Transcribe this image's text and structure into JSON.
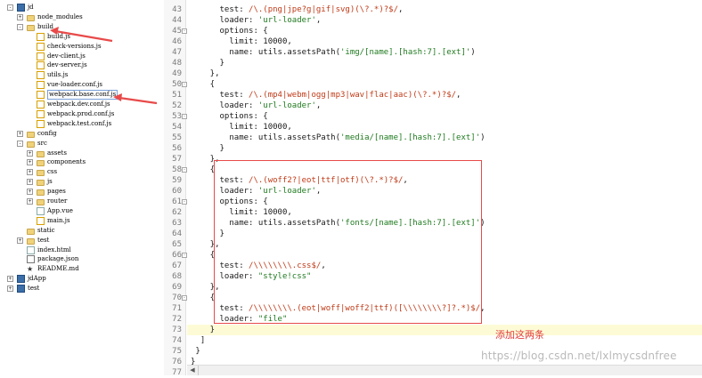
{
  "tree": {
    "items": [
      {
        "label": "jd",
        "level": 0,
        "icon": "project",
        "toggle": "-"
      },
      {
        "label": "node_modules",
        "level": 1,
        "icon": "folder",
        "toggle": "+"
      },
      {
        "label": "build",
        "level": 1,
        "icon": "folder",
        "toggle": "-"
      },
      {
        "label": "build.js",
        "level": 2,
        "icon": "file-js"
      },
      {
        "label": "check-versions.js",
        "level": 2,
        "icon": "file-js"
      },
      {
        "label": "dev-client.js",
        "level": 2,
        "icon": "file-js"
      },
      {
        "label": "dev-server.js",
        "level": 2,
        "icon": "file-js"
      },
      {
        "label": "utils.js",
        "level": 2,
        "icon": "file-js"
      },
      {
        "label": "vue-loader.conf.js",
        "level": 2,
        "icon": "file-js"
      },
      {
        "label": "webpack.base.conf.js",
        "level": 2,
        "icon": "file-js",
        "selected": true
      },
      {
        "label": "webpack.dev.conf.js",
        "level": 2,
        "icon": "file-js"
      },
      {
        "label": "webpack.prod.conf.js",
        "level": 2,
        "icon": "file-js"
      },
      {
        "label": "webpack.test.conf.js",
        "level": 2,
        "icon": "file-js"
      },
      {
        "label": "config",
        "level": 1,
        "icon": "folder",
        "toggle": "+"
      },
      {
        "label": "src",
        "level": 1,
        "icon": "folder",
        "toggle": "-"
      },
      {
        "label": "assets",
        "level": 2,
        "icon": "folder",
        "toggle": "+"
      },
      {
        "label": "components",
        "level": 2,
        "icon": "folder",
        "toggle": "+"
      },
      {
        "label": "css",
        "level": 2,
        "icon": "folder",
        "toggle": "+"
      },
      {
        "label": "js",
        "level": 2,
        "icon": "folder",
        "toggle": "+"
      },
      {
        "label": "pages",
        "level": 2,
        "icon": "folder",
        "toggle": "+"
      },
      {
        "label": "router",
        "level": 2,
        "icon": "folder",
        "toggle": "+"
      },
      {
        "label": "App.vue",
        "level": 2,
        "icon": "file"
      },
      {
        "label": "main.js",
        "level": 2,
        "icon": "file-js"
      },
      {
        "label": "static",
        "level": 1,
        "icon": "folder"
      },
      {
        "label": "test",
        "level": 1,
        "icon": "folder",
        "toggle": "+"
      },
      {
        "label": "index.html",
        "level": 1,
        "icon": "file"
      },
      {
        "label": "package.json",
        "level": 1,
        "icon": "file-json"
      },
      {
        "label": "README.md",
        "level": 1,
        "icon": "star"
      },
      {
        "label": "jdApp",
        "level": 0,
        "icon": "project",
        "toggle": "+"
      },
      {
        "label": "test",
        "level": 0,
        "icon": "project",
        "toggle": "+"
      }
    ]
  },
  "editor": {
    "lines": [
      {
        "n": "43",
        "fold": "",
        "tokens": [
          [
            "p",
            "      "
          ],
          [
            "key",
            "test: "
          ],
          [
            "re",
            "/\\.(png|jpe?g|gif|svg)(\\?.*)?$/"
          ],
          [
            "p",
            ","
          ]
        ]
      },
      {
        "n": "44",
        "fold": "",
        "tokens": [
          [
            "p",
            "      "
          ],
          [
            "key",
            "loader: "
          ],
          [
            "str",
            "'url-loader'"
          ],
          [
            "p",
            ","
          ]
        ]
      },
      {
        "n": "45",
        "fold": "-",
        "tokens": [
          [
            "p",
            "      "
          ],
          [
            "key",
            "options: {"
          ]
        ]
      },
      {
        "n": "46",
        "fold": "",
        "tokens": [
          [
            "p",
            "        "
          ],
          [
            "key",
            "limit: "
          ],
          [
            "num",
            "10000"
          ],
          [
            "p",
            ","
          ]
        ]
      },
      {
        "n": "47",
        "fold": "",
        "tokens": [
          [
            "p",
            "        "
          ],
          [
            "key",
            "name: utils.assetsPath("
          ],
          [
            "str",
            "'img/[name].[hash:7].[ext]'"
          ],
          [
            "p",
            ")"
          ]
        ]
      },
      {
        "n": "48",
        "fold": "",
        "tokens": [
          [
            "p",
            "      }"
          ]
        ]
      },
      {
        "n": "49",
        "fold": "",
        "tokens": [
          [
            "p",
            "    },"
          ]
        ]
      },
      {
        "n": "50",
        "fold": "-",
        "tokens": [
          [
            "p",
            "    {"
          ]
        ]
      },
      {
        "n": "51",
        "fold": "",
        "tokens": [
          [
            "p",
            "      "
          ],
          [
            "key",
            "test: "
          ],
          [
            "re",
            "/\\.(mp4|webm|ogg|mp3|wav|flac|aac)(\\?.*)?$/"
          ],
          [
            "p",
            ","
          ]
        ]
      },
      {
        "n": "52",
        "fold": "",
        "tokens": [
          [
            "p",
            "      "
          ],
          [
            "key",
            "loader: "
          ],
          [
            "str",
            "'url-loader'"
          ],
          [
            "p",
            ","
          ]
        ]
      },
      {
        "n": "53",
        "fold": "-",
        "tokens": [
          [
            "p",
            "      "
          ],
          [
            "key",
            "options: {"
          ]
        ]
      },
      {
        "n": "54",
        "fold": "",
        "tokens": [
          [
            "p",
            "        "
          ],
          [
            "key",
            "limit: "
          ],
          [
            "num",
            "10000"
          ],
          [
            "p",
            ","
          ]
        ]
      },
      {
        "n": "55",
        "fold": "",
        "tokens": [
          [
            "p",
            "        "
          ],
          [
            "key",
            "name: utils.assetsPath("
          ],
          [
            "str",
            "'media/[name].[hash:7].[ext]'"
          ],
          [
            "p",
            ")"
          ]
        ]
      },
      {
        "n": "56",
        "fold": "",
        "tokens": [
          [
            "p",
            "      }"
          ]
        ]
      },
      {
        "n": "57",
        "fold": "",
        "tokens": [
          [
            "p",
            "    },"
          ]
        ]
      },
      {
        "n": "58",
        "fold": "-",
        "tokens": [
          [
            "p",
            "    {"
          ]
        ]
      },
      {
        "n": "59",
        "fold": "",
        "tokens": [
          [
            "p",
            "      "
          ],
          [
            "key",
            "test: "
          ],
          [
            "re",
            "/\\.(woff2?|eot|ttf|otf)(\\?.*)?$/"
          ],
          [
            "p",
            ","
          ]
        ]
      },
      {
        "n": "60",
        "fold": "",
        "tokens": [
          [
            "p",
            "      "
          ],
          [
            "key",
            "loader: "
          ],
          [
            "str",
            "'url-loader'"
          ],
          [
            "p",
            ","
          ]
        ]
      },
      {
        "n": "61",
        "fold": "-",
        "tokens": [
          [
            "p",
            "      "
          ],
          [
            "key",
            "options: {"
          ]
        ]
      },
      {
        "n": "62",
        "fold": "",
        "tokens": [
          [
            "p",
            "        "
          ],
          [
            "key",
            "limit: "
          ],
          [
            "num",
            "10000"
          ],
          [
            "p",
            ","
          ]
        ]
      },
      {
        "n": "63",
        "fold": "",
        "tokens": [
          [
            "p",
            "        "
          ],
          [
            "key",
            "name: utils.assetsPath("
          ],
          [
            "str",
            "'fonts/[name].[hash:7].[ext]'"
          ],
          [
            "p",
            ")"
          ]
        ]
      },
      {
        "n": "64",
        "fold": "",
        "tokens": [
          [
            "p",
            "      }"
          ]
        ]
      },
      {
        "n": "65",
        "fold": "",
        "tokens": [
          [
            "p",
            "    },"
          ]
        ]
      },
      {
        "n": "66",
        "fold": "-",
        "tokens": [
          [
            "p",
            "    {"
          ]
        ]
      },
      {
        "n": "67",
        "fold": "",
        "tokens": [
          [
            "p",
            "      "
          ],
          [
            "key",
            "test: "
          ],
          [
            "re",
            "/\\\\\\\\\\\\\\\\.css$/"
          ],
          [
            "p",
            ","
          ]
        ]
      },
      {
        "n": "68",
        "fold": "",
        "tokens": [
          [
            "p",
            "      "
          ],
          [
            "key",
            "loader: "
          ],
          [
            "str",
            "\"style!css\""
          ]
        ]
      },
      {
        "n": "69",
        "fold": "",
        "tokens": [
          [
            "p",
            "    },"
          ]
        ]
      },
      {
        "n": "70",
        "fold": "-",
        "tokens": [
          [
            "p",
            "    {"
          ]
        ]
      },
      {
        "n": "71",
        "fold": "",
        "tokens": [
          [
            "p",
            "      "
          ],
          [
            "key",
            "test: "
          ],
          [
            "re",
            "/\\\\\\\\\\\\\\\\.(eot|woff|woff2|ttf)([\\\\\\\\\\\\\\\\?]?.*)$/"
          ],
          [
            "p",
            ","
          ]
        ]
      },
      {
        "n": "72",
        "fold": "",
        "tokens": [
          [
            "p",
            "      "
          ],
          [
            "key",
            "loader: "
          ],
          [
            "str",
            "\"file\""
          ]
        ]
      },
      {
        "n": "73",
        "fold": "",
        "hl": true,
        "tokens": [
          [
            "p",
            "    }"
          ]
        ]
      },
      {
        "n": "74",
        "fold": "",
        "tokens": [
          [
            "p",
            "  ]"
          ]
        ]
      },
      {
        "n": "75",
        "fold": "",
        "tokens": [
          [
            "p",
            " }"
          ]
        ]
      },
      {
        "n": "76",
        "fold": "",
        "tokens": [
          [
            "p",
            "}"
          ]
        ]
      },
      {
        "n": "77",
        "fold": "",
        "tokens": [
          [
            "p",
            ""
          ]
        ]
      }
    ]
  },
  "annotation": {
    "text": "添加这两条"
  },
  "watermark": {
    "text": "https://blog.csdn.net/lxlmycsdnfree"
  },
  "colors": {
    "annotation_red": "#e23c3c",
    "regex": "#c03a17",
    "string": "#1f7a1f",
    "current_line": "#fdfbd6"
  }
}
